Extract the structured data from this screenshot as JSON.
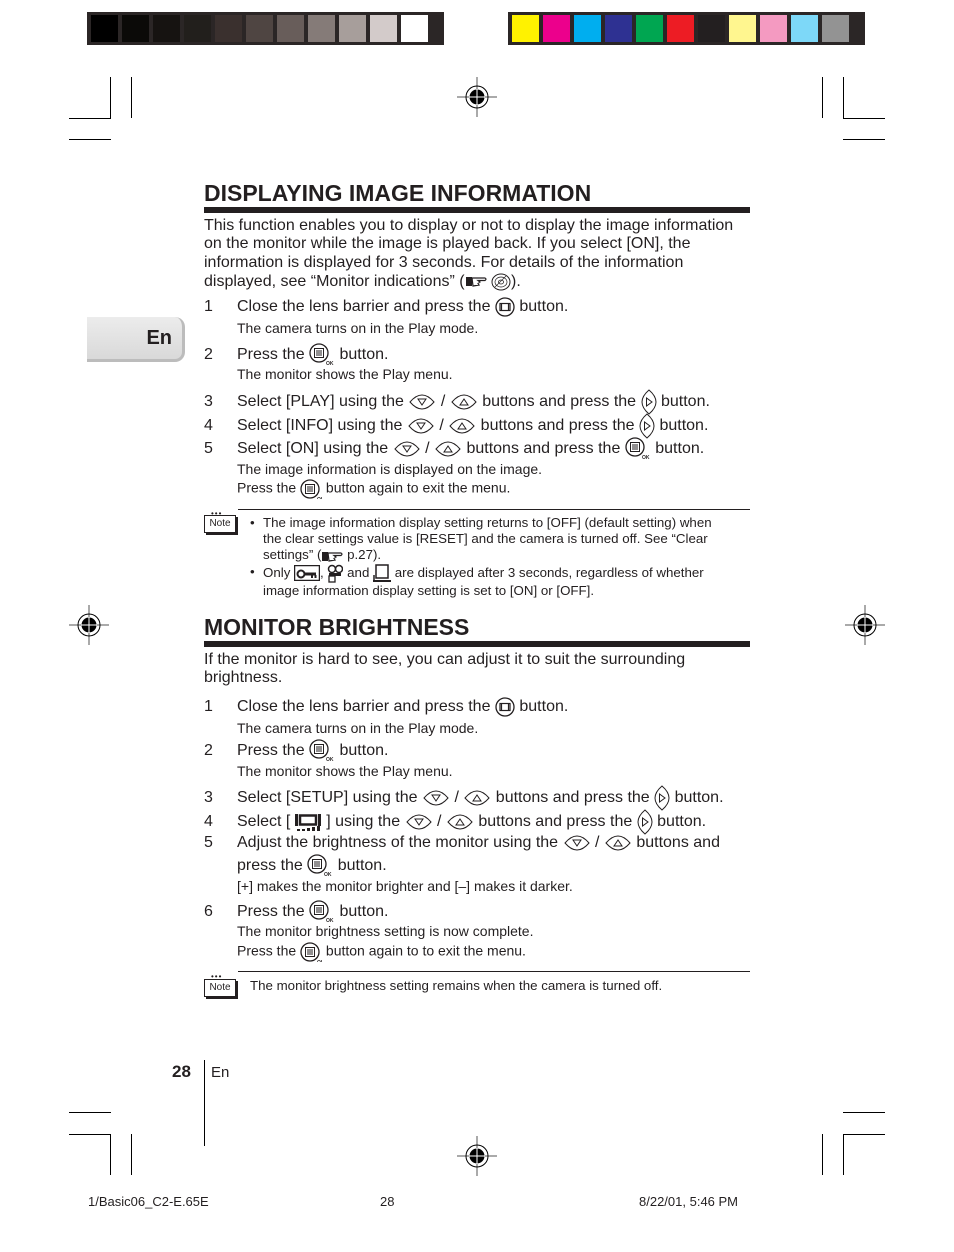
{
  "color_bars": {
    "grayscale": [
      "#000000",
      "#0b0a08",
      "#161311",
      "#221f1c",
      "#3a302e",
      "#4f4542",
      "#685d5a",
      "#857b78",
      "#a79e9b",
      "#d3cbca",
      "#ffffff"
    ],
    "process": [
      "#fff200",
      "#ec008c",
      "#00aeef",
      "#2e3192",
      "#00a651",
      "#ed1c24",
      "#231f20",
      "#fff68f",
      "#f49ac1",
      "#7dd8f8",
      "#939393"
    ]
  },
  "language_tab": "En",
  "section1": {
    "title": "DISPLAYING IMAGE INFORMATION",
    "intro_lines": [
      "This function enables you to display or not to display the image information",
      "on the monitor while the image is played back. If you select [ON], the",
      "information is displayed for 3 seconds. For details of the information",
      "displayed, see “Monitor indications” ("
    ],
    "intro_end": ").",
    "steps": [
      {
        "num": "1",
        "before": "Close the lens barrier and press the",
        "icon": "play-button-icon",
        "after": "button.",
        "subs": [
          "The camera turns on in the Play mode."
        ]
      },
      {
        "num": "2",
        "before": "Press the",
        "icon": "menu-ok-button-icon",
        "after": "button.",
        "subs": [
          "The monitor shows the Play menu."
        ]
      },
      {
        "num": "3",
        "before": "Select [PLAY] using the",
        "mid": "/",
        "middle": "buttons and press the",
        "icon": "right-arrow-button-icon",
        "after": "button."
      },
      {
        "num": "4",
        "before": "Select [INFO] using the",
        "mid": "/",
        "middle": "buttons and press the",
        "icon": "right-arrow-button-icon",
        "after": "button."
      },
      {
        "num": "5",
        "before": "Select [ON] using the",
        "mid": "/",
        "middle": "buttons and press the",
        "icon": "menu-ok-button-icon",
        "after": "button.",
        "subs": [
          "The image information is displayed on the image."
        ],
        "sub2_before": "Press the",
        "sub2_after": "button again to exit the menu."
      }
    ],
    "note_label": "Note",
    "notes": [
      {
        "lines": [
          "The image information display setting returns to [OFF] (default setting) when",
          "the clear settings value is [RESET] and the camera is turned off. See “Clear",
          "settings” ("
        ],
        "ref": "p.27)."
      },
      {
        "before": "Only",
        "comma": ",",
        "and": "and",
        "after": "are displayed after 3 seconds, regardless of whether",
        "line2": "image information display setting is set to [ON] or [OFF]."
      }
    ]
  },
  "section2": {
    "title": "MONITOR BRIGHTNESS",
    "intro_lines": [
      "If the monitor is hard to see, you can adjust it to suit the surrounding",
      "brightness."
    ],
    "steps": [
      {
        "num": "1",
        "before": "Close the lens barrier and press the",
        "after": "button.",
        "subs": [
          "The camera turns on in the Play mode."
        ]
      },
      {
        "num": "2",
        "before": "Press the",
        "after": "button.",
        "subs": [
          "The monitor shows the Play menu."
        ]
      },
      {
        "num": "3",
        "before": "Select [SETUP] using the",
        "mid": "/",
        "middle": "buttons and press the",
        "after": "button."
      },
      {
        "num": "4",
        "before": "Select [",
        "before2": "] using the",
        "mid": "/",
        "middle": "buttons and press the",
        "after": "button."
      },
      {
        "num": "5",
        "before": "Adjust the brightness of the monitor using the",
        "mid": "/",
        "middle": "buttons and",
        "line2_before": "press the",
        "line2_after": "button.",
        "subs": [
          "[+] makes the monitor brighter and [–] makes it darker."
        ]
      },
      {
        "num": "6",
        "before": "Press the",
        "after": "button.",
        "subs": [
          "The monitor brightness setting is now complete."
        ],
        "sub2_before": "Press the",
        "sub2_after": "button again to to exit the menu."
      }
    ],
    "note_label": "Note",
    "note": "The monitor brightness setting remains when the camera is turned off."
  },
  "page": {
    "number": "28",
    "lang": "En"
  },
  "footer": {
    "file": "1/Basic06_C2-E.65E",
    "page": "28",
    "timestamp": "8/22/01, 5:46 PM"
  }
}
